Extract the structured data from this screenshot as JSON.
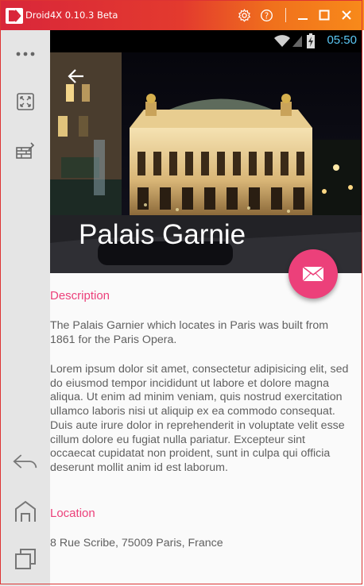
{
  "window": {
    "title": "Droid4X 0.10.3 Beta"
  },
  "statusbar": {
    "time": "05:50"
  },
  "hero": {
    "title": "Palais Garnie"
  },
  "description": {
    "heading": "Description",
    "intro": "The Palais Garnier which locates in Paris was built from 1861 for the Paris Opera.",
    "body": "Lorem ipsum dolor sit amet, consectetur adipisicing elit, sed do eiusmod tempor incididunt ut labore et dolore magna aliqua. Ut enim ad minim veniam, quis nostrud exercitation ullamco laboris nisi ut aliquip ex ea commodo consequat. Duis aute irure dolor in reprehenderit in voluptate velit esse cillum dolore eu fugiat nulla pariatur. Excepteur sint occaecat cupidatat non proident, sunt in culpa qui officia deserunt mollit anim id est laborum."
  },
  "location": {
    "heading": "Location",
    "address": "8 Rue Scribe, 75009 Paris, France"
  },
  "icons": {
    "settings": "gear-icon",
    "help": "help-icon",
    "minimize": "minimize-icon",
    "maximize": "maximize-icon",
    "close": "close-icon",
    "more": "more-icon",
    "fullscreen": "fullscreen-icon",
    "apk": "apk-install-icon",
    "back": "back-icon",
    "home": "home-icon",
    "recents": "recents-icon",
    "email": "email-icon",
    "wifi": "wifi-icon",
    "signal": "signal-icon",
    "battery": "battery-icon"
  },
  "colors": {
    "accent": "#ec407a",
    "titlebar_start": "#d9263a",
    "titlebar_end": "#f88a1a",
    "clock": "#5bc8f5"
  }
}
